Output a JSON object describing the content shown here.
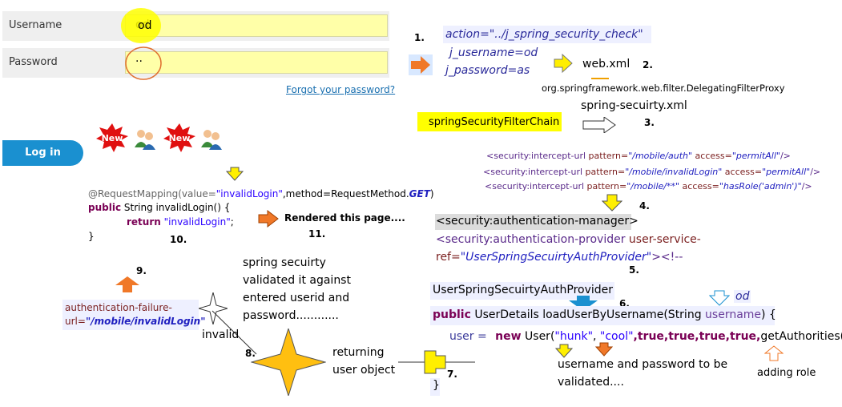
{
  "login_form": {
    "username_label": "Username",
    "username_value": "od",
    "password_label": "Password",
    "password_value": "··",
    "forgot_link": "Forgot your password?",
    "login_button": "Log in"
  },
  "steps": {
    "s1": "1.",
    "s2": "2.",
    "s3": "3.",
    "s4": "4.",
    "s5": "5.",
    "s6": "6.",
    "s7": "7.",
    "s8": "8.",
    "s9": "9.",
    "s10": "10.",
    "s11": "11."
  },
  "request": {
    "action": "action=\"../j_spring_security_check\"",
    "username": "j_username=od",
    "password": "j_password=as"
  },
  "config": {
    "web_xml": "web.xml",
    "delegating_filter": "org.springframework.web.filter.DelegatingFilterProxy",
    "spring_security_xml": "spring-secuirty.xml",
    "filter_chain": "springSecurityFilterChain"
  },
  "intercept_urls": [
    {
      "prefix": "<security:intercept-url",
      "attr1": " pattern=",
      "val1": "\"/mobile/auth\"",
      "attr2": " access=",
      "val2": "\"permitAll\"",
      "end": "/>"
    },
    {
      "prefix": "<security:intercept-url",
      "attr1": " pattern=",
      "val1": "\"/mobile/invalidLogin\"",
      "attr2": " access=",
      "val2": "\"permitAll\"",
      "end": "/>"
    },
    {
      "prefix": "<security:intercept-url",
      "attr1": " pattern=",
      "val1": "\"/mobile/**\"",
      "attr2": " access=",
      "val2": "\"hasRole('admin')\"",
      "end": "/>"
    }
  ],
  "auth_manager": {
    "manager_tag": "<security:authentication-manager>",
    "provider_line1_tag": "<security:authentication-provider",
    "provider_line1_attr": " user-service-",
    "provider_line2_attr": "ref=",
    "provider_line2_val": "\"UserSpringSecuirtyAuthProvider\"",
    "provider_line2_end": "><!--"
  },
  "provider_code": {
    "class_name": "UserSpringSecuirtyAuthProvider",
    "od_label": "od",
    "sig_kw": "public",
    "sig_rest": " UserDetails loadUserByUsername(String ",
    "sig_param": "username",
    "sig_end": ") {",
    "user_prefix": "user = ",
    "new_kw": "new",
    "user_call": " User(",
    "arg1": "\"hunk\"",
    "arg_sep": ", ",
    "arg2": "\"cool\"",
    "bools": ",true,true,true,true,",
    "tail": "getAuthorities());",
    "closing": "}",
    "note_credentials_1": "username and password to be",
    "note_credentials_2": "validated....",
    "note_role": "adding role"
  },
  "returning": {
    "line1": "returning",
    "line2": "user object"
  },
  "validation": {
    "line1": "spring secuirty",
    "line2": "validated it against",
    "line3": "entered userid and",
    "line4": "password............",
    "invalid": "invalid"
  },
  "failure_url": {
    "line1": "authentication-failure-",
    "line2_prefix": "url=",
    "line2_val": "\"/mobile/invalidLogin\""
  },
  "controller_code": {
    "annotation": "@RequestMapping(value=",
    "value": "\"invalidLogin\"",
    "method": ",method=RequestMethod.",
    "method_val": "GET",
    "close": ")",
    "sig_kw": "public",
    "sig_rest": " String invalidLogin() {",
    "return_kw": "return",
    "return_val": "\"invalidLogin\"",
    "return_end": ";",
    "closing": "}"
  },
  "rendered": "Rendered this page....",
  "badges": [
    "New",
    "New"
  ],
  "colors": {
    "accent_blue": "#1a90d0",
    "highlight_yellow": "#ffff00",
    "arrow_orange": "#f07828",
    "arrow_yellow": "#ffef00",
    "star_gold": "#ffbf10"
  }
}
